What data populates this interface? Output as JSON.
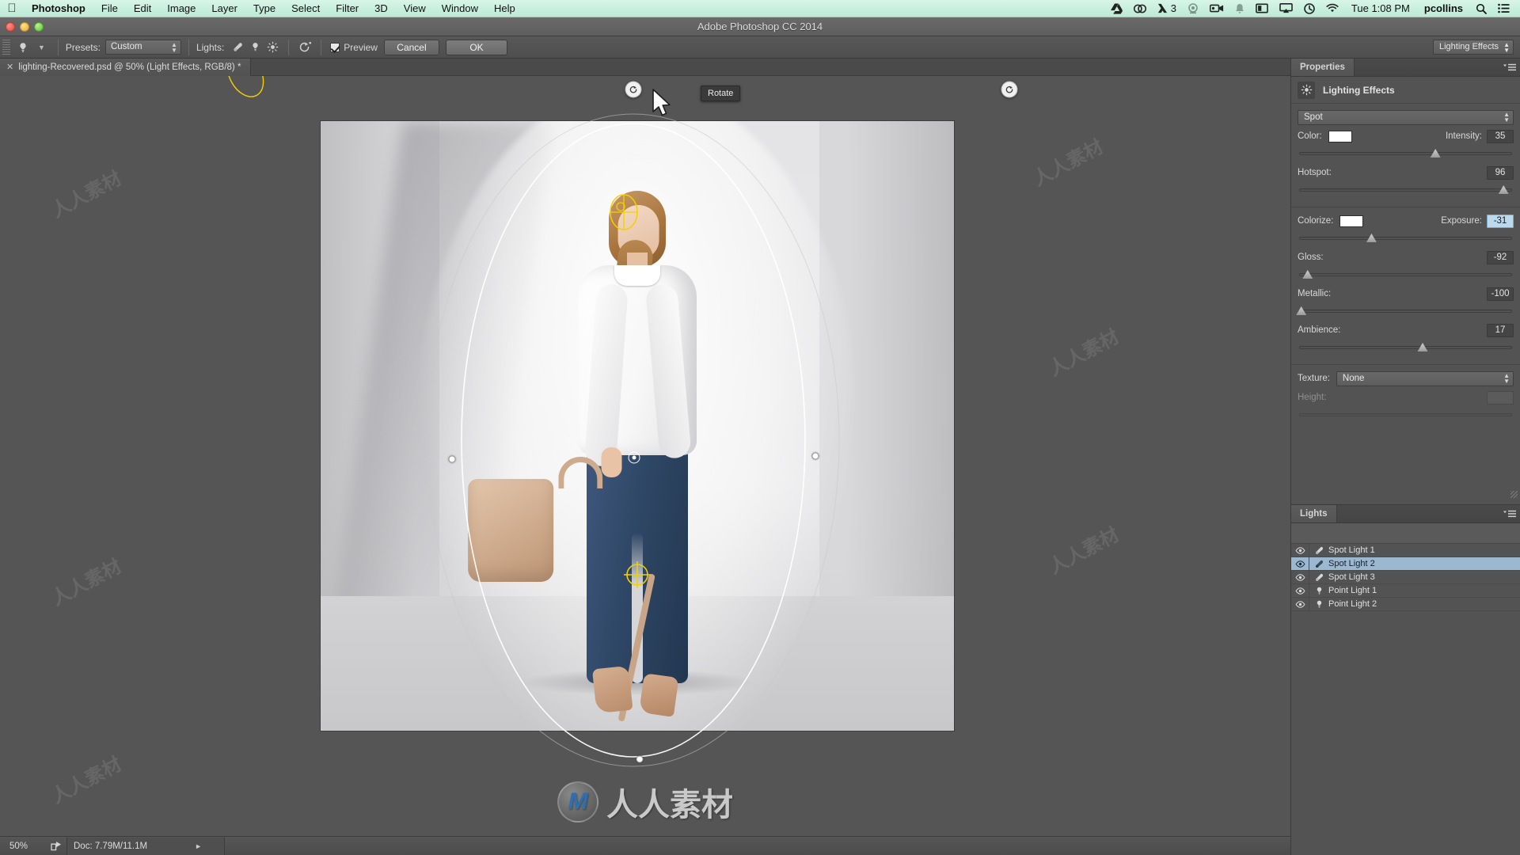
{
  "mac_menubar": {
    "apple_icon": "apple-icon",
    "app_name": "Photoshop",
    "menus": [
      "File",
      "Edit",
      "Image",
      "Layer",
      "Type",
      "Select",
      "Filter",
      "3D",
      "View",
      "Window",
      "Help"
    ],
    "status_icons": [
      "google-drive-icon",
      "creative-cloud-icon",
      "adobe-app-icon",
      "dropcam-icon",
      "screen-record-icon",
      "bell-icon",
      "display-icon",
      "airplay-icon",
      "time-machine-icon",
      "wifi-icon"
    ],
    "adobe_badge_count": "3",
    "clock": "Tue 1:08 PM",
    "user": "pcollins",
    "search_icon": "search-icon",
    "notification_center_icon": "list-icon"
  },
  "window": {
    "title": "Adobe Photoshop CC 2014"
  },
  "options_bar": {
    "tool_icon": "lighting-effects-tool-icon",
    "presets_label": "Presets:",
    "presets_value": "Custom",
    "lights_label": "Lights:",
    "light_tools": [
      "spot-light-icon",
      "point-light-icon",
      "infinite-light-icon"
    ],
    "reset_icon": "reset-lights-icon",
    "preview_label": "Preview",
    "preview_checked": true,
    "cancel_label": "Cancel",
    "ok_label": "OK",
    "workspace_value": "Lighting Effects"
  },
  "document_tab": {
    "close_icon": "close-icon",
    "label": "lighting-Recovered.psd @ 50% (Light Effects, RGB/8) *"
  },
  "canvas": {
    "tooltip": "Rotate",
    "cursor_icon": "arrow-cursor",
    "rotate_handle_icon": "rotate-handle-icon",
    "watermark_text": "人人素材",
    "watermark_mark": "M"
  },
  "properties_panel": {
    "tab_label": "Properties",
    "menu_icon": "panel-menu-icon",
    "header_icon": "lighting-effects-icon",
    "header_title": "Lighting Effects",
    "light_type": "Spot",
    "color_label": "Color:",
    "color_value": "#ffffff",
    "intensity_label": "Intensity:",
    "intensity_value": "35",
    "intensity_pct": 64,
    "hotspot_label": "Hotspot:",
    "hotspot_value": "96",
    "hotspot_pct": 96,
    "colorize_label": "Colorize:",
    "colorize_value": "#ffffff",
    "exposure_label": "Exposure:",
    "exposure_value": "-31",
    "exposure_pct": 34,
    "gloss_label": "Gloss:",
    "gloss_value": "-92",
    "gloss_pct": 4,
    "metallic_label": "Metallic:",
    "metallic_value": "-100",
    "metallic_pct": 0,
    "ambience_label": "Ambience:",
    "ambience_value": "17",
    "ambience_pct": 58,
    "texture_label": "Texture:",
    "texture_value": "None",
    "height_label": "Height:",
    "height_value": "",
    "height_pct": 0
  },
  "lights_panel": {
    "tab_label": "Lights",
    "menu_icon": "panel-menu-icon",
    "rows": [
      {
        "visible": true,
        "icon": "spot-light-icon",
        "name": "Spot Light 1",
        "selected": false
      },
      {
        "visible": true,
        "icon": "spot-light-icon",
        "name": "Spot Light 2",
        "selected": true
      },
      {
        "visible": true,
        "icon": "spot-light-icon",
        "name": "Spot Light 3",
        "selected": false
      },
      {
        "visible": true,
        "icon": "point-light-icon",
        "name": "Point Light 1",
        "selected": false
      },
      {
        "visible": true,
        "icon": "point-light-icon",
        "name": "Point Light 2",
        "selected": false
      }
    ]
  },
  "status_bar": {
    "zoom": "50%",
    "share_icon": "share-icon",
    "doc_info": "Doc: 7.79M/11.1M",
    "expand_icon": "triangle-right-icon"
  },
  "colors": {
    "accent_selection": "#9cb8d0",
    "panel_bg": "#535353",
    "canvas_bg": "#555555",
    "menubar_bg": "#cdf0e0",
    "light_guide": "#ffffff",
    "active_light_yellow": "#f2d000"
  }
}
